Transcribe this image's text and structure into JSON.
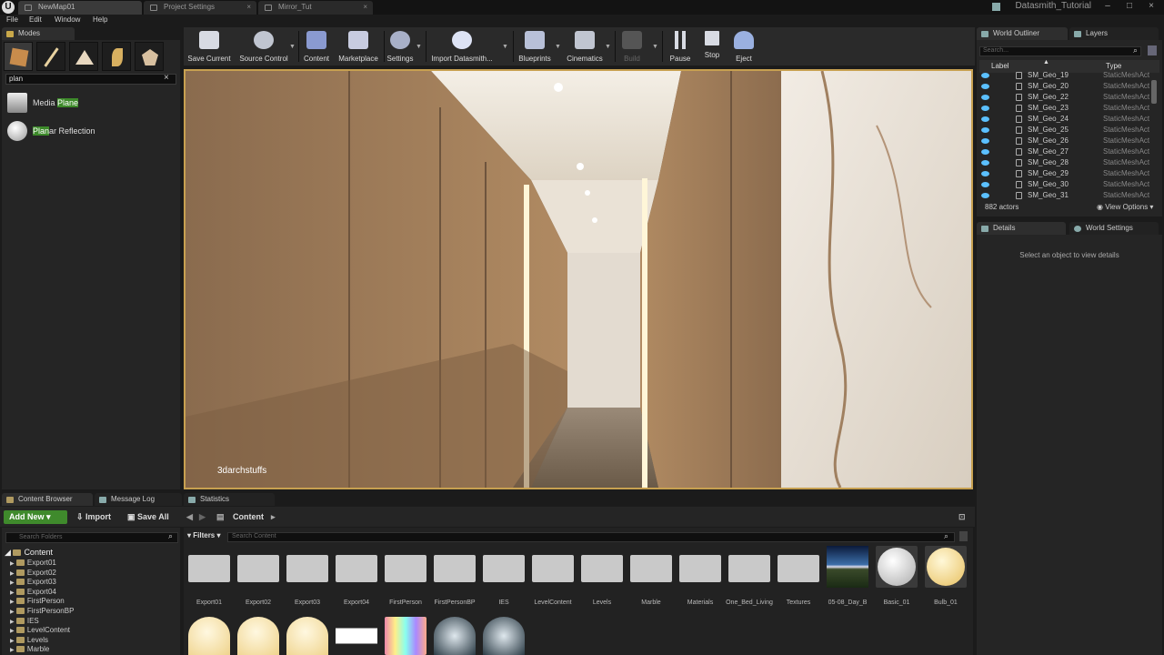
{
  "window": {
    "tabs": [
      "NewMap01",
      "Project Settings",
      "Mirror_Tut"
    ],
    "project_name": "Datasmith_Tutorial",
    "logo": "U"
  },
  "menu": [
    "File",
    "Edit",
    "Window",
    "Help"
  ],
  "modes": {
    "tab_label": "Modes",
    "search_value": "plan",
    "results": [
      {
        "prefix": "Media ",
        "match": "Plane",
        "suffix": ""
      },
      {
        "prefix": "",
        "match": "Plan",
        "suffix": "ar Reflection"
      }
    ]
  },
  "toolbar": {
    "buttons": [
      "Save Current",
      "Source Control",
      "Content",
      "Marketplace",
      "Settings",
      "Import Datasmith...",
      "Blueprints",
      "Cinematics",
      "Build",
      "Pause",
      "Stop",
      "Eject"
    ]
  },
  "viewport": {
    "watermark": "3darchstuffs"
  },
  "outliner": {
    "tabs": [
      "World Outliner",
      "Layers"
    ],
    "search_placeholder": "Search...",
    "col_label": "Label",
    "col_type": "Type",
    "rows": [
      {
        "name": "SM_Geo_19",
        "type": "StaticMeshAct"
      },
      {
        "name": "SM_Geo_20",
        "type": "StaticMeshAct"
      },
      {
        "name": "SM_Geo_22",
        "type": "StaticMeshAct"
      },
      {
        "name": "SM_Geo_23",
        "type": "StaticMeshAct"
      },
      {
        "name": "SM_Geo_24",
        "type": "StaticMeshAct"
      },
      {
        "name": "SM_Geo_25",
        "type": "StaticMeshAct"
      },
      {
        "name": "SM_Geo_26",
        "type": "StaticMeshAct"
      },
      {
        "name": "SM_Geo_27",
        "type": "StaticMeshAct"
      },
      {
        "name": "SM_Geo_28",
        "type": "StaticMeshAct"
      },
      {
        "name": "SM_Geo_29",
        "type": "StaticMeshAct"
      },
      {
        "name": "SM_Geo_30",
        "type": "StaticMeshAct"
      },
      {
        "name": "SM_Geo_31",
        "type": "StaticMeshAct"
      }
    ],
    "actor_count": "882 actors",
    "view_options": "View Options"
  },
  "details": {
    "tabs": [
      "Details",
      "World Settings"
    ],
    "empty_text": "Select an object to view details"
  },
  "bottom_tabs": [
    "Content Browser",
    "Message Log",
    "Statistics"
  ],
  "content_browser": {
    "add_new": "Add New",
    "import": "Import",
    "save_all": "Save All",
    "path": "Content",
    "folder_search_placeholder": "Search Folders",
    "filters": "Filters",
    "search_placeholder": "Search Content",
    "tree": [
      "Content",
      "Export01",
      "Export02",
      "Export03",
      "Export04",
      "FirstPerson",
      "FirstPersonBP",
      "IES",
      "LevelContent",
      "Levels",
      "Marble"
    ],
    "folders": [
      "Export01",
      "Export02",
      "Export03",
      "Export04",
      "FirstPerson",
      "FirstPersonBP",
      "IES",
      "LevelContent",
      "Levels",
      "Marble",
      "Materials",
      "One_Bed_Living",
      "Textures"
    ],
    "assets": [
      "05-08_Day_B",
      "Basic_01",
      "Bulb_01"
    ]
  }
}
